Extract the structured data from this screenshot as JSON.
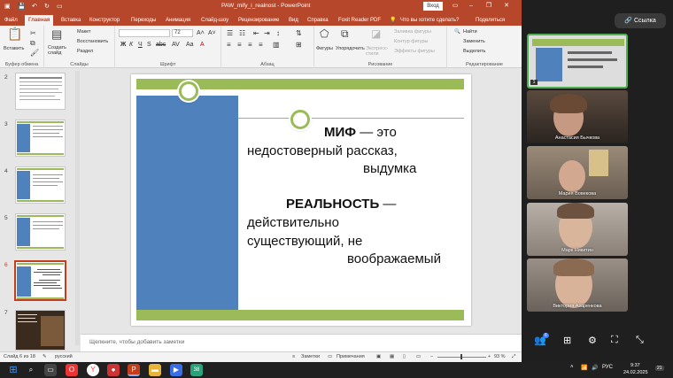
{
  "window": {
    "title": "PAW_mify_i_realnost - PowerPoint",
    "signin": "Вход"
  },
  "tabs": [
    "Файл",
    "Главная",
    "Вставка",
    "Конструктор",
    "Переходы",
    "Анимация",
    "Слайд-шоу",
    "Рецензирование",
    "Вид",
    "Справка",
    "Foxit Reader PDF"
  ],
  "tell_me": "Что вы хотите сделать?",
  "share": "Поделиться",
  "ribbon": {
    "clipboard": {
      "paste": "Вставить",
      "label": "Буфер обмена"
    },
    "slides": {
      "create": "Создать слайд",
      "layout": "Макет",
      "reset": "Восстановить",
      "section": "Раздел",
      "label": "Слайды"
    },
    "font": {
      "size": "72",
      "label": "Шрифт"
    },
    "paragraph": {
      "label": "Абзац"
    },
    "drawing": {
      "shapes": "Фигуры",
      "arrange": "Упорядочить",
      "quick_styles": "Экспресс-стили",
      "fill": "Заливка фигуры",
      "outline": "Контур фигуры",
      "effects": "Эффекты фигуры",
      "label": "Рисование"
    },
    "editing": {
      "find": "Найти",
      "replace": "Заменить",
      "select": "Выделить",
      "label": "Редактирование"
    }
  },
  "thumbnails": [
    {
      "num": "2",
      "selected": false
    },
    {
      "num": "3",
      "selected": false
    },
    {
      "num": "4",
      "selected": false
    },
    {
      "num": "5",
      "selected": false
    },
    {
      "num": "6",
      "selected": true
    },
    {
      "num": "7",
      "selected": false
    }
  ],
  "slide": {
    "myth_term": "МИФ",
    "myth_def_1": " — это",
    "myth_def_2": "недостоверный рассказ,",
    "myth_def_3": "выдумка",
    "reality_term": "РЕАЛЬНОСТЬ",
    "reality_def_1": " —",
    "reality_def_2": "действительно",
    "reality_def_3": "существующий, не",
    "reality_def_4": "воображаемый"
  },
  "notes_placeholder": "Щелкните, чтобы добавить заметки",
  "status": {
    "slide": "Слайд 6 из 18",
    "lang": "русский",
    "notes": "Заметки",
    "comments": "Примечания",
    "zoom": "93 %"
  },
  "call": {
    "link_button": "Ссылка",
    "participants": [
      {
        "name": "Анастасия Бычкова"
      },
      {
        "name": "Мария Вовекова"
      },
      {
        "name": "Марк Никитин"
      },
      {
        "name": "Виктория Азаренкова"
      }
    ],
    "badge": "6"
  },
  "taskbar": {
    "lang": "РУС",
    "time": "9:37",
    "date": "24.02.2025",
    "notif": "21"
  },
  "colors": {
    "ppt_red": "#b7472a",
    "slide_green": "#9bbb59",
    "slide_blue": "#4f81bd"
  }
}
